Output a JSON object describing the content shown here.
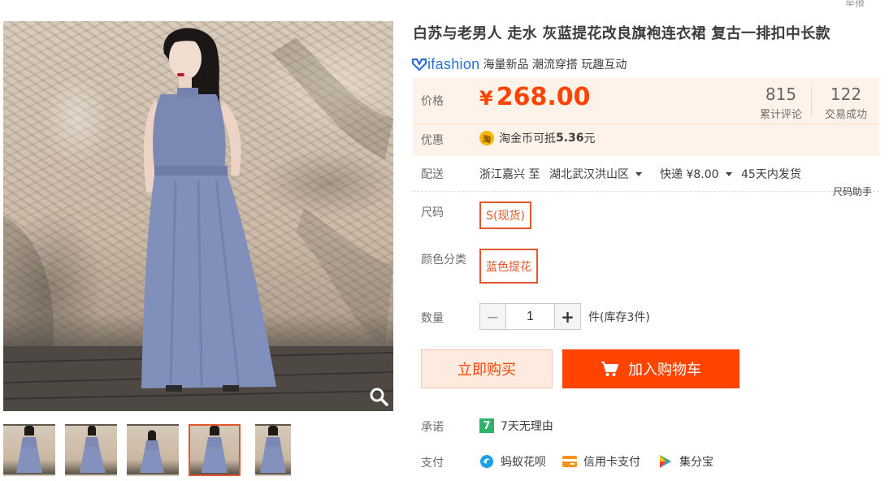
{
  "top_right_text": "举报",
  "product": {
    "title": "白苏与老男人 走水 灰蓝提花改良旗袍连衣裙 复古一排扣中长款"
  },
  "brand": {
    "logo_text": "ifashion",
    "tagline": "海量新品 潮流穿搭 玩趣互动"
  },
  "price": {
    "label": "价格",
    "currency_symbol": "¥",
    "amount": "268.00",
    "reviews_count": "815",
    "reviews_label": "累计评论",
    "sales_count": "122",
    "sales_label": "交易成功"
  },
  "promo": {
    "label": "优惠",
    "coin_glyph": "淘",
    "text_prefix": "淘金币可抵",
    "amount": "5.36",
    "unit": "元"
  },
  "delivery": {
    "label": "配送",
    "from": "浙江嘉兴 至",
    "to": "湖北武汉洪山区",
    "shipping": "快递 ¥8.00",
    "eta": "45天内发货",
    "size_helper": "尺码助手"
  },
  "sku": {
    "size_label": "尺码",
    "size_option": "S(现货)",
    "color_label": "颜色分类",
    "color_option": "蓝色提花"
  },
  "quantity": {
    "label": "数量",
    "minus": "−",
    "value": "1",
    "plus": "+",
    "stock_text": "件(库存3件)"
  },
  "actions": {
    "buy_now": "立即购买",
    "add_to_cart": "加入购物车"
  },
  "services": {
    "promise_label": "承诺",
    "promise_icon_text": "7",
    "promise_text": "7天无理由",
    "payment_label": "支付",
    "payments": [
      "蚂蚁花呗",
      "信用卡支付",
      "集分宝"
    ]
  },
  "colors": {
    "accent": "#ff4400",
    "selected_border": "#e4572e",
    "price_bg": "#fff2e8",
    "brand_blue": "#2b6fd6"
  },
  "icons": {
    "zoom": "magnifier-icon",
    "cart": "cart-icon",
    "promise": "seven-day-icon",
    "huabei": "huabei-icon",
    "credit_card": "credit-card-icon",
    "jifenbao": "jifenbao-icon"
  }
}
